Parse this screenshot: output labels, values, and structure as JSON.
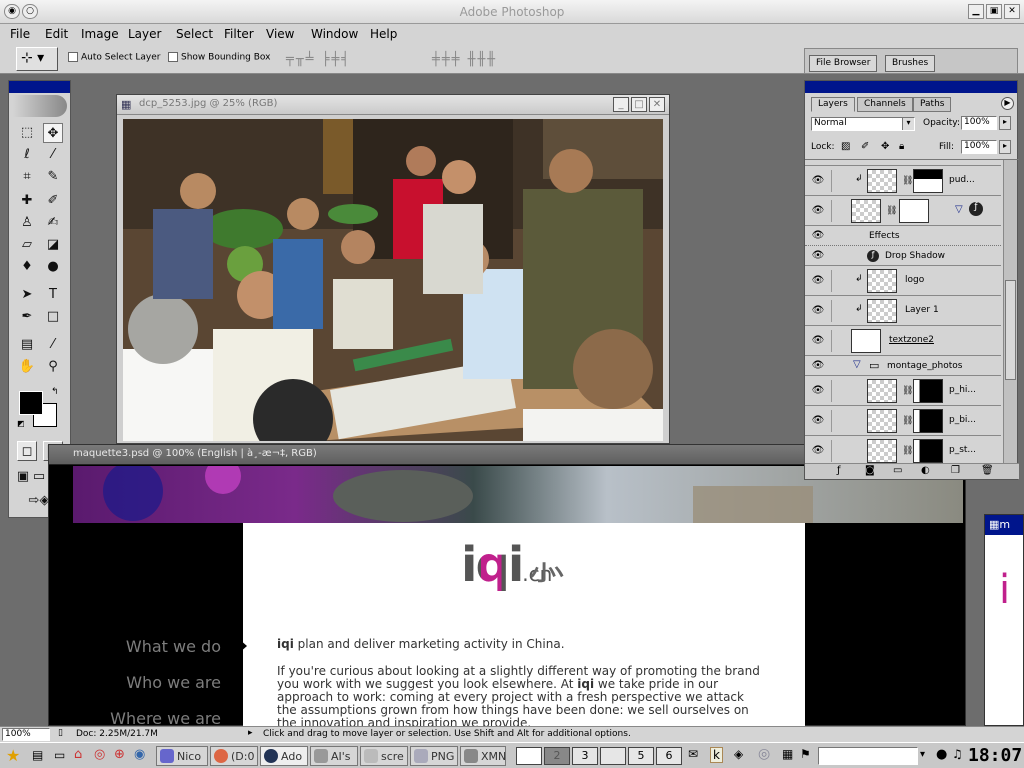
{
  "app": {
    "title": "Adobe Photoshop"
  },
  "menu": [
    "File",
    "Edit",
    "Image",
    "Layer",
    "Select",
    "Filter",
    "View",
    "Window",
    "Help"
  ],
  "options": {
    "auto_select": "Auto Select Layer",
    "bounding_box": "Show Bounding Box"
  },
  "well_tabs": [
    "File Browser",
    "Brushes"
  ],
  "doc1": {
    "title": "dcp_5253.jpg @ 25% (RGB)"
  },
  "doc2": {
    "title": "maquette3.psd @ 100% (English | à¸-æ¬‡, RGB)"
  },
  "site": {
    "logo_main": "iqi",
    "logo_suffix": ".cn",
    "nav": [
      "What we do",
      "Who we are",
      "Where we are"
    ],
    "brand": "iqi",
    "p1_rest": " plan and deliver marketing activity in China.",
    "p2_a": "If you're curious about looking at a slightly different way of promoting the brand you work with we suggest you look elsewhere. At ",
    "p2_b": "iqi",
    "p2_c": " we take pride in our approach to work: coming at every project with a fresh perspective we attack the assumptions grown from how things have been done: we sell ourselves on the innovation and inspiration we provide."
  },
  "layers_panel": {
    "tabs": [
      "Layers",
      "Channels",
      "Paths"
    ],
    "blend_mode": "Normal",
    "opacity_label": "Opacity:",
    "opacity": "100%",
    "lock_label": "Lock:",
    "fill_label": "Fill:",
    "fill": "100%",
    "rows": [
      "pud...",
      "",
      "Effects",
      "Drop Shadow",
      "logo",
      "Layer 1",
      "textzone2",
      "montage_photos",
      "p_hi...",
      "p_bi...",
      "p_st..."
    ]
  },
  "status": {
    "zoom": "100%",
    "doc": "Doc: 2.25M/21.7M",
    "hint": "Click and drag to move layer or selection.  Use Shift and Alt for additional options."
  },
  "taskbar": {
    "tasks": [
      "Nico",
      "(D:0",
      "Ado",
      "AI's",
      "scre",
      "PNG",
      "XMN"
    ],
    "desktops": [
      "",
      "2",
      "3",
      "",
      "5",
      "6"
    ],
    "clock": "18:07"
  },
  "colors": {
    "accent": "#00158c",
    "magenta": "#c0208c",
    "nav_gray": "#7d7d7d"
  }
}
